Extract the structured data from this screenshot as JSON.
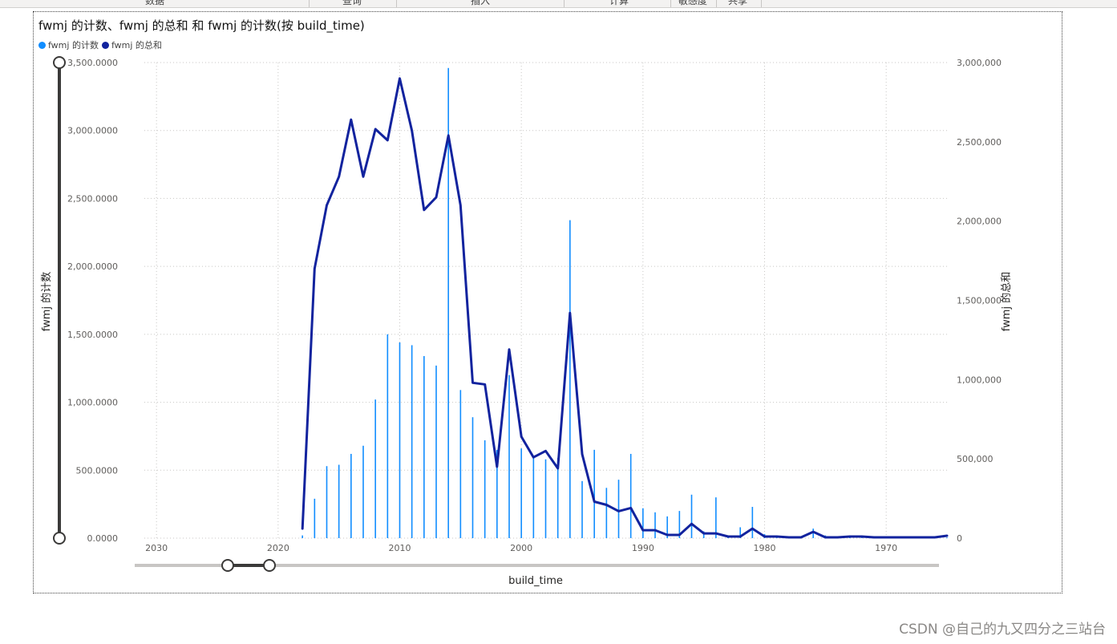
{
  "ribbon": {
    "items": [
      {
        "label": "数据",
        "color": "#444444"
      },
      {
        "label": "查询",
        "color": "#444444"
      },
      {
        "label": "插入",
        "color": "#444444"
      },
      {
        "label": "计算",
        "color": "#444444"
      },
      {
        "label": "敏感度",
        "color": "#444444"
      },
      {
        "label": "共享",
        "color": "#444444"
      }
    ]
  },
  "visual": {
    "title": "fwmj 的计数、fwmj 的总和 和 fwmj 的计数(按 build_time)",
    "legend": [
      {
        "label": "fwmj 的计数",
        "color": "#118DFF"
      },
      {
        "label": "fwmj 的总和",
        "color": "#12239E"
      }
    ],
    "x_axis_label": "build_time",
    "y_left_label": "fwmj 的计数",
    "y_right_label": "fwmj 的总和",
    "zoom_slider_y": {
      "low": 0.0,
      "high": 1.0
    },
    "zoom_slider_x": {
      "low": 0.115,
      "high": 0.167
    }
  },
  "watermark": "CSDN @自己的九又四分之三站台",
  "chart_data": {
    "type": "bar",
    "x_order": "descending",
    "xlim": [
      2031,
      1965
    ],
    "x_ticks": [
      2030,
      2020,
      2010,
      2000,
      1990,
      1980,
      1970
    ],
    "x_tick_labels": [
      "2030",
      "2020",
      "2010",
      "2000",
      "1990",
      "1980",
      "1970"
    ],
    "y_left": {
      "ylim": [
        0,
        3500
      ],
      "ticks": [
        0,
        500,
        1000,
        1500,
        2000,
        2500,
        3000,
        3500
      ],
      "tick_labels": [
        "0.0000",
        "500.0000",
        "1,000.0000",
        "1,500.0000",
        "2,000.0000",
        "2,500.0000",
        "3,000.0000",
        "3,500.0000"
      ]
    },
    "y_right": {
      "ylim": [
        0,
        3000000
      ],
      "ticks": [
        0,
        500000,
        1000000,
        1500000,
        2000000,
        2500000,
        3000000
      ],
      "tick_labels": [
        "0",
        "500,000",
        "1,000,000",
        "1,500,000",
        "2,000,000",
        "2,500,000",
        "3,000,000"
      ]
    },
    "grid": true,
    "legend_position": "top-left",
    "series": [
      {
        "name": "fwmj 的计数",
        "type": "bar",
        "axis": "left",
        "color": "#118DFF",
        "x": [
          2018,
          2017,
          2016,
          2015,
          2014,
          2013,
          2012,
          2011,
          2010,
          2009,
          2008,
          2007,
          2006,
          2005,
          2004,
          2003,
          2002,
          2001,
          2000,
          1999,
          1998,
          1997,
          1996,
          1995,
          1994,
          1993,
          1992,
          1991,
          1990,
          1989,
          1988,
          1987,
          1986,
          1985,
          1984,
          1983,
          1982,
          1981,
          1980,
          1979,
          1978,
          1977,
          1976,
          1975,
          1974,
          1973,
          1972,
          1971,
          1970,
          1969,
          1968,
          1967,
          1966,
          1965
        ],
        "values": [
          20,
          290,
          530,
          540,
          620,
          680,
          1020,
          1500,
          1440,
          1420,
          1340,
          1270,
          3460,
          1090,
          890,
          720,
          650,
          1200,
          660,
          590,
          580,
          590,
          2340,
          420,
          650,
          370,
          430,
          620,
          220,
          190,
          160,
          200,
          320,
          50,
          300,
          20,
          80,
          230,
          30,
          10,
          5,
          5,
          70,
          20,
          5,
          5,
          5,
          5,
          5,
          5,
          5,
          5,
          5,
          5
        ]
      },
      {
        "name": "fwmj 的总和",
        "type": "line",
        "axis": "right",
        "color": "#12239E",
        "x": [
          2018,
          2017,
          2016,
          2015,
          2014,
          2013,
          2012,
          2011,
          2010,
          2009,
          2008,
          2007,
          2006,
          2005,
          2004,
          2003,
          2002,
          2001,
          2000,
          1999,
          1998,
          1997,
          1996,
          1995,
          1994,
          1993,
          1992,
          1991,
          1990,
          1989,
          1988,
          1987,
          1986,
          1985,
          1984,
          1983,
          1982,
          1981,
          1980,
          1979,
          1978,
          1977,
          1976,
          1975,
          1974,
          1973,
          1972,
          1971,
          1970,
          1969,
          1968,
          1967,
          1966,
          1965
        ],
        "values": [
          60000,
          1700000,
          2100000,
          2280000,
          2640000,
          2280000,
          2580000,
          2510000,
          2900000,
          2570000,
          2070000,
          2150000,
          2540000,
          2100000,
          980000,
          970000,
          450000,
          1190000,
          640000,
          510000,
          550000,
          440000,
          1420000,
          530000,
          230000,
          210000,
          170000,
          190000,
          50000,
          50000,
          20000,
          20000,
          90000,
          30000,
          30000,
          10000,
          10000,
          60000,
          10000,
          10000,
          5000,
          5000,
          40000,
          5000,
          5000,
          10000,
          10000,
          5000,
          5000,
          5000,
          5000,
          5000,
          5000,
          15000
        ]
      }
    ]
  }
}
